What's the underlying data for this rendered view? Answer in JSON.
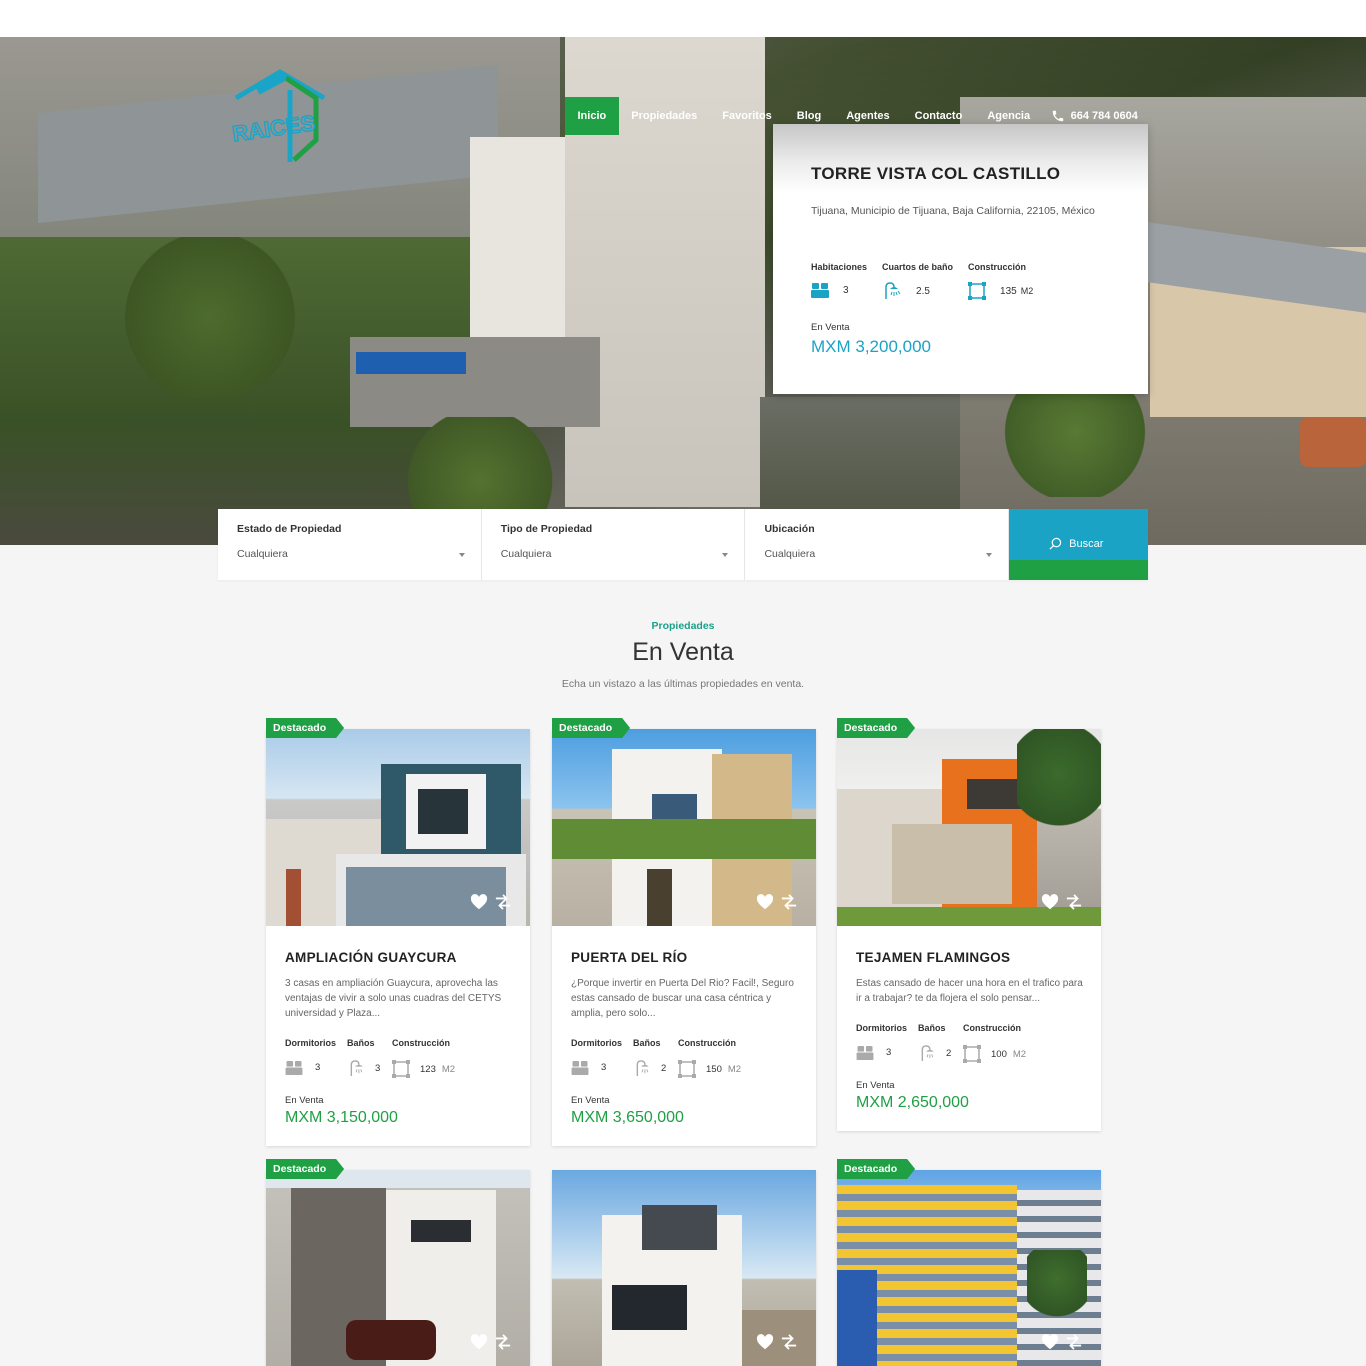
{
  "header": {
    "logo_text": "RAICES",
    "nav": [
      {
        "label": "Inicio",
        "active": true
      },
      {
        "label": "Propiedades",
        "active": false
      },
      {
        "label": "Favoritos",
        "active": false
      },
      {
        "label": "Blog",
        "active": false
      },
      {
        "label": "Agentes",
        "active": false
      },
      {
        "label": "Contacto",
        "active": false
      },
      {
        "label": "Agencia",
        "active": false
      }
    ],
    "phone": "664 784 0604"
  },
  "featured": {
    "title": "TORRE VISTA COL CASTILLO",
    "address": "Tijuana, Municipio de Tijuana, Baja California, 22105, México",
    "specs": [
      {
        "label": "Habitaciones",
        "value": "3",
        "icon": "bed-icon"
      },
      {
        "label": "Cuartos de baño",
        "value": "2.5",
        "icon": "shower-icon"
      },
      {
        "label": "Construcción",
        "value": "135",
        "unit": "M2",
        "icon": "area-icon"
      }
    ],
    "status": "En Venta",
    "price": "MXM 3,200,000"
  },
  "search": {
    "fields": [
      {
        "label": "Estado de Propiedad",
        "value": "Cualquiera"
      },
      {
        "label": "Tipo de Propiedad",
        "value": "Cualquiera"
      },
      {
        "label": "Ubicación",
        "value": "Cualquiera"
      }
    ],
    "button": "Buscar"
  },
  "section": {
    "kicker": "Propiedades",
    "title": "En Venta",
    "subtitle": "Echa un vistazo a las últimas propiedades en venta."
  },
  "labels": {
    "badge": "Destacado",
    "beds": "Dormitorios",
    "baths": "Baños",
    "area": "Construcción",
    "unit": "M2"
  },
  "listings": [
    {
      "title": "AMPLIACIÓN GUAYCURA",
      "description": "3 casas en ampliación Guaycura, aprovecha las ventajas de vivir a solo unas cuadras del CETYS universidad y Plaza...",
      "beds": "3",
      "baths": "3",
      "area": "123",
      "status": "En Venta",
      "price": "MXM 3,150,000",
      "featured": true
    },
    {
      "title": "PUERTA DEL RÍO",
      "description": "¿Porque invertir en Puerta Del Rio? Facil!, Seguro estas cansado de buscar una casa céntrica y amplia, pero solo...",
      "beds": "3",
      "baths": "2",
      "area": "150",
      "status": "En Venta",
      "price": "MXM 3,650,000",
      "featured": true
    },
    {
      "title": "TEJAMEN FLAMINGOS",
      "description": "Estas cansado de hacer una hora en el trafico para ir a trabajar? te da flojera el solo pensar...",
      "beds": "3",
      "baths": "2",
      "area": "100",
      "status": "En Venta",
      "price": "MXM 2,650,000",
      "featured": true
    },
    {
      "featured": true
    },
    {
      "featured": false
    },
    {
      "featured": true
    }
  ],
  "colors": {
    "green": "#1fa045",
    "blue": "#1ba3c6",
    "teal": "#1aa08a"
  }
}
